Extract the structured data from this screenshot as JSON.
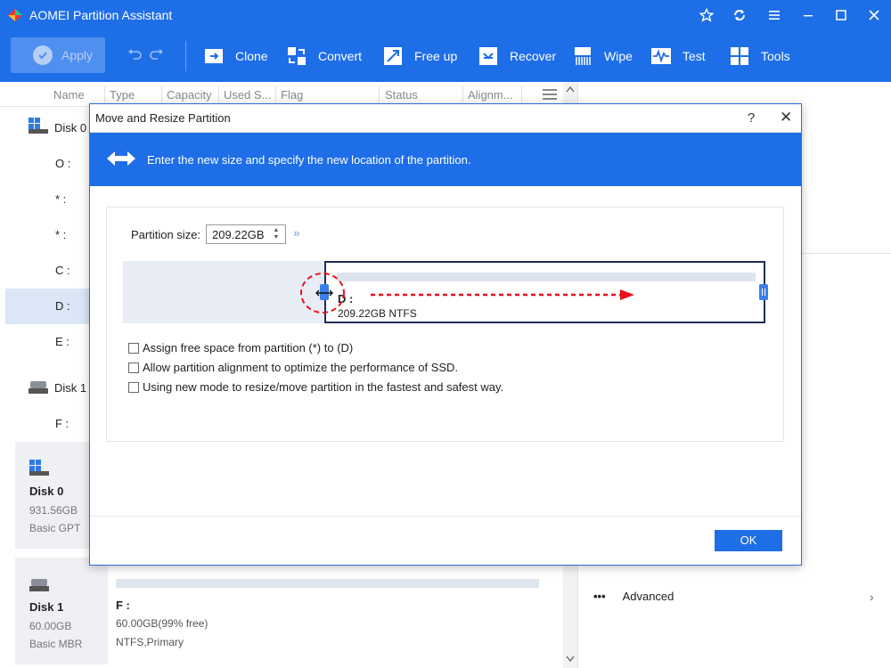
{
  "app": {
    "title": "AOMEI Partition Assistant"
  },
  "toolbar": {
    "apply_label": "Apply",
    "tools": [
      {
        "label": "Clone",
        "icon": "clone-icon"
      },
      {
        "label": "Convert",
        "icon": "convert-icon"
      },
      {
        "label": "Free up",
        "icon": "free-up-icon"
      },
      {
        "label": "Recover",
        "icon": "recover-icon"
      },
      {
        "label": "Wipe",
        "icon": "wipe-icon"
      },
      {
        "label": "Test",
        "icon": "test-icon"
      },
      {
        "label": "Tools",
        "icon": "tools-icon"
      }
    ]
  },
  "columns": [
    "Name",
    "Type",
    "Capacity",
    "Used S...",
    "Flag",
    "Status",
    "Alignm..."
  ],
  "tree": {
    "disk0": "Disk 0",
    "disk0_parts": [
      "O :",
      "* :",
      "* :",
      "C :",
      "D :",
      "E :"
    ],
    "disk1": "Disk 1",
    "disk1_parts": [
      "F :"
    ]
  },
  "cards": {
    "disk0": {
      "name": "Disk 0",
      "size": "931.56GB",
      "type": "Basic GPT"
    },
    "disk1": {
      "name": "Disk 1",
      "size": "60.00GB",
      "type": "Basic MBR",
      "partition": {
        "name": "F :",
        "free": "60.00GB(99% free)",
        "fs": "NTFS,Primary"
      }
    }
  },
  "right_panel": {
    "advanced": "Advanced"
  },
  "dialog": {
    "title": "Move and Resize Partition",
    "help": "?",
    "close": "✕",
    "banner_text": "Enter the new size and specify the new location of the partition.",
    "size_label": "Partition size:",
    "size_value": "209.22GB",
    "partition_name": "D :",
    "partition_size": "209.22GB NTFS",
    "options": [
      "Assign free space from partition (*) to (D)",
      "Allow partition alignment to optimize the performance of SSD.",
      "Using new mode to resize/move partition in the fastest and safest way."
    ],
    "ok_label": "OK"
  },
  "colors": {
    "accent": "#1e6ee8",
    "annotation": "#e8101c"
  }
}
